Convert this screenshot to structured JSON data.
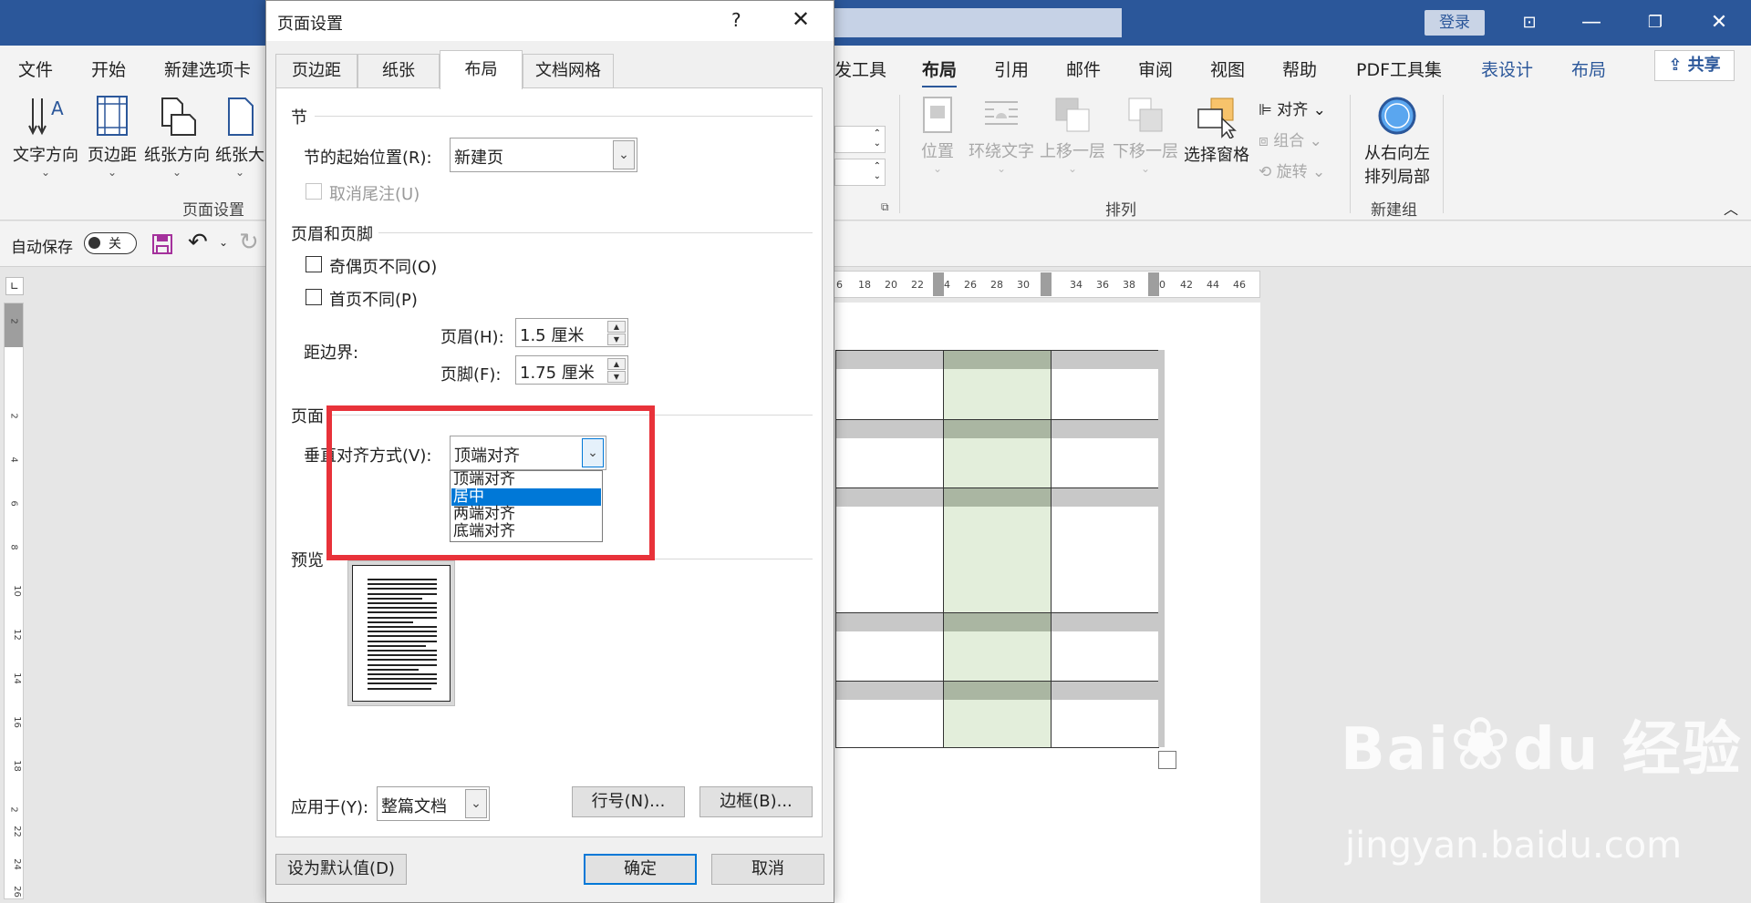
{
  "titlebar": {
    "login": "登录",
    "controls": {
      "restore_ribbon": "⊡",
      "minimize": "—",
      "maximize": "❐",
      "close": "✕"
    }
  },
  "tabs": {
    "file": "文件",
    "home": "开始",
    "new_tab": "新建选项卡",
    "dev_tools": "发工具",
    "layout": "布局",
    "references": "引用",
    "mail": "邮件",
    "review": "审阅",
    "view": "视图",
    "help": "帮助",
    "pdf": "PDF工具集",
    "table_design": "表设计",
    "table_layout": "布局",
    "share": "共享"
  },
  "ribbon": {
    "text_direction": "文字方向",
    "margins": "页边距",
    "orientation": "纸张方向",
    "size": "纸张大",
    "page_setup_group": "页面设置",
    "position": "位置",
    "wrap_text": "环绕文字",
    "bring_forward": "上移一层",
    "send_backward": "下移一层",
    "selection_pane": "选择窗格",
    "align": "对齐",
    "group": "组合",
    "rotate": "旋转",
    "arrange_group": "排列",
    "rtl_line1": "从右向左",
    "rtl_line2": "排列局部",
    "new_group": "新建组"
  },
  "qat": {
    "autosave": "自动保存",
    "toggle_off": "关"
  },
  "ruler": {
    "h_numbers": [
      "6",
      "18",
      "20",
      "22",
      "4",
      "26",
      "28",
      "30",
      "34",
      "36",
      "38",
      "0",
      "42",
      "44",
      "46"
    ],
    "v_numbers": [
      "2",
      "2",
      "4",
      "6",
      "8",
      "10",
      "12",
      "14",
      "16",
      "18",
      "2",
      "22",
      "24",
      "26"
    ]
  },
  "watermark": {
    "brand": "Bai",
    "brand2": "du",
    "brand3": "经验",
    "url": "jingyan.baidu.com"
  },
  "dialog": {
    "title": "页面设置",
    "help": "?",
    "close": "✕",
    "tabs": [
      "页边距",
      "纸张",
      "布局",
      "文档网格"
    ],
    "section_title": "节",
    "section_start_label": "节的起始位置(R):",
    "section_start_value": "新建页",
    "suppress_endnotes": "取消尾注(U)",
    "header_footer_title": "页眉和页脚",
    "odd_even_different": "奇偶页不同(O)",
    "first_page_different": "首页不同(P)",
    "from_edge_label": "距边界:",
    "header_label": "页眉(H):",
    "header_value": "1.5 厘米",
    "footer_label": "页脚(F):",
    "footer_value": "1.75 厘米",
    "page_title": "页面",
    "vertical_align_label": "垂直对齐方式(V):",
    "vertical_align_value": "顶端对齐",
    "vertical_align_options": [
      "顶端对齐",
      "居中",
      "两端对齐",
      "底端对齐"
    ],
    "preview_title": "预览",
    "apply_to_label": "应用于(Y):",
    "apply_to_value": "整篇文档",
    "line_numbers_button": "行号(N)...",
    "borders_button": "边框(B)...",
    "set_default_button": "设为默认值(D)",
    "ok_button": "确定",
    "cancel_button": "取消"
  },
  "colors": {
    "word_blue": "#2b579a",
    "highlight_red": "#e8323a",
    "select_blue": "#0078d7"
  }
}
